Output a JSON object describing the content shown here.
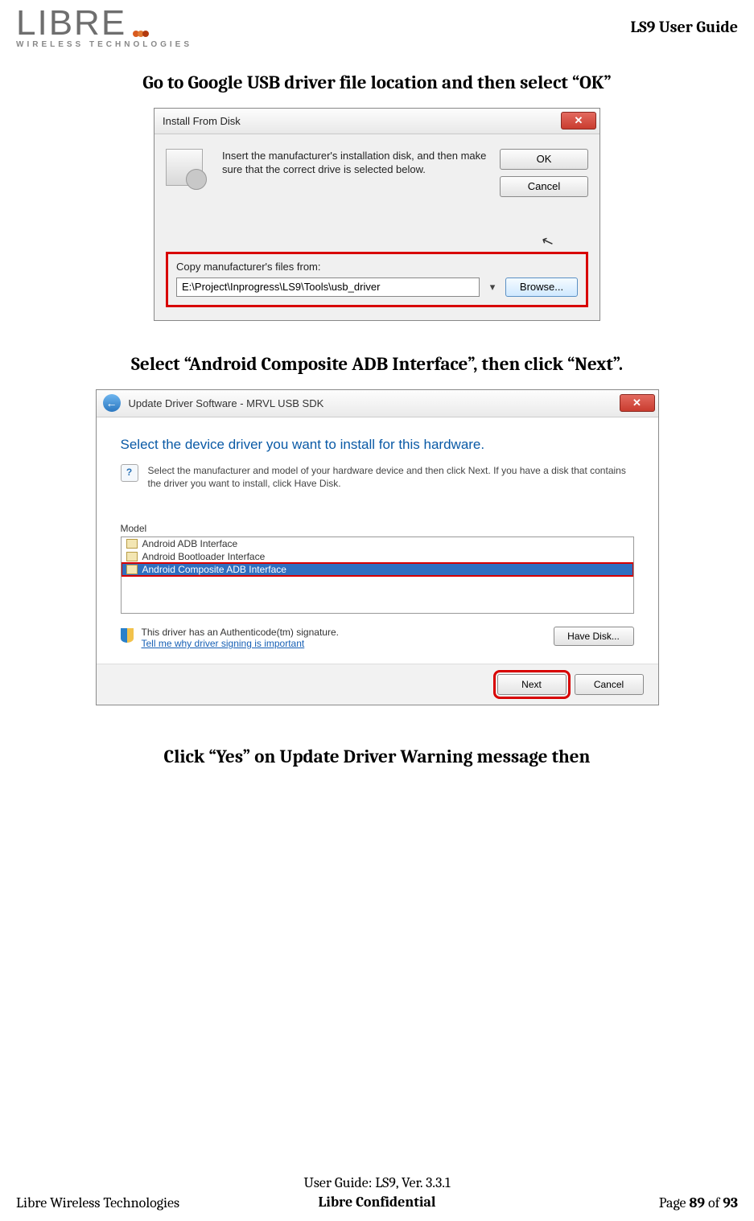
{
  "header": {
    "logo_main": "LIBRE",
    "logo_sub": "WIRELESS TECHNOLOGIES",
    "doc_title": "LS9 User Guide"
  },
  "instruction1": "Go to Google USB driver file location and then select “OK”",
  "dlg1": {
    "title": "Install From Disk",
    "body_text": "Insert the manufacturer's installation disk, and then make sure that the correct drive is selected below.",
    "ok": "OK",
    "cancel": "Cancel",
    "copy_label": "Copy manufacturer's files from:",
    "path": "E:\\Project\\Inprogress\\LS9\\Tools\\usb_driver",
    "browse": "Browse..."
  },
  "instruction2": "Select “Android Composite ADB Interface”, then click “Next”.",
  "dlg2": {
    "title": "Update Driver Software - MRVL USB SDK",
    "heading": "Select the device driver you want to install for this hardware.",
    "subtext": "Select the manufacturer and model of your hardware device and then click Next. If you have a disk that contains the driver you want to install, click Have Disk.",
    "model_label": "Model",
    "models": {
      "m0": "Android ADB Interface",
      "m1": "Android Bootloader Interface",
      "m2": "Android Composite ADB Interface"
    },
    "auth_text": "This driver has an Authenticode(tm) signature.",
    "auth_link": "Tell me why driver signing is important",
    "have_disk": "Have Disk...",
    "next": "Next",
    "cancel": "Cancel"
  },
  "instruction3": "Click “Yes” on Update Driver Warning message then",
  "footer": {
    "left": "Libre Wireless Technologies",
    "center_line1": "User Guide: LS9, Ver. 3.3.1",
    "center_line2": "Libre Confidential",
    "right_prefix": "Page ",
    "page_cur": "89",
    "right_mid": " of ",
    "page_total": "93"
  }
}
